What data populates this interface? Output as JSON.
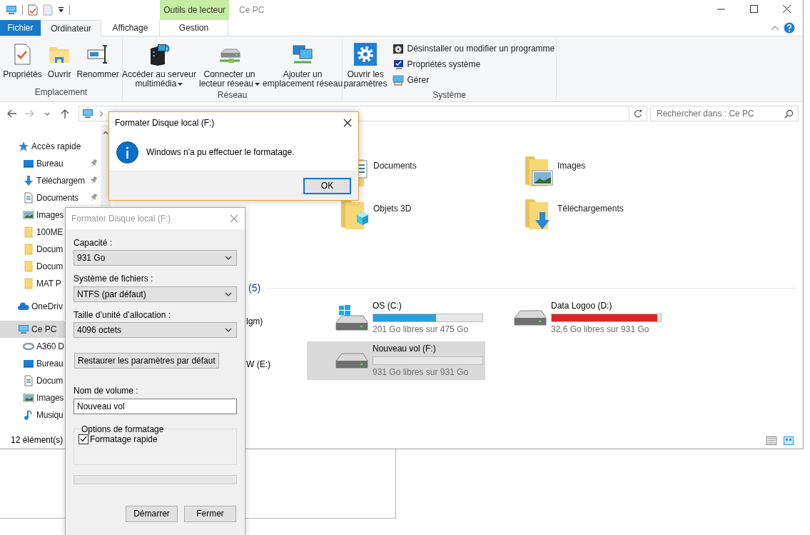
{
  "window": {
    "title": "Ce PC",
    "context_tab": "Outils de lecteur"
  },
  "ribbon_tabs": [
    {
      "label": "Fichier",
      "kind": "file",
      "selected": false
    },
    {
      "label": "Ordinateur",
      "kind": "tab",
      "selected": true
    },
    {
      "label": "Affichage",
      "kind": "tab",
      "selected": false
    },
    {
      "label": "Gestion",
      "kind": "context",
      "selected": false
    }
  ],
  "ribbon_groups": [
    {
      "label": "Emplacement",
      "commands": [
        {
          "label": "Propriétés",
          "kind": "large",
          "dropdown": false
        },
        {
          "label": "Ouvrir",
          "kind": "large",
          "dropdown": false
        },
        {
          "label": "Renommer",
          "kind": "large",
          "dropdown": false
        }
      ]
    },
    {
      "label": "Réseau",
      "commands": [
        {
          "label": "Accéder au serveur\nmultimédia",
          "kind": "large",
          "dropdown": true
        },
        {
          "label": "Connecter un\nlecteur réseau",
          "kind": "large",
          "dropdown": true
        },
        {
          "label": "Ajouter un\nemplacement réseau",
          "kind": "large",
          "dropdown": false
        }
      ]
    },
    {
      "label": "Système",
      "commands": [
        {
          "label": "Ouvrir les\nparamètres",
          "kind": "large",
          "dropdown": false
        },
        {
          "label": "Désinstaller ou modifier un programme",
          "kind": "small",
          "dropdown": false
        },
        {
          "label": "Propriétés système",
          "kind": "small",
          "dropdown": false
        },
        {
          "label": "Gérer",
          "kind": "small",
          "dropdown": false
        }
      ]
    }
  ],
  "search": {
    "placeholder": "Rechercher dans : Ce PC"
  },
  "nav_pane": {
    "items": [
      {
        "label": "Accès rapide",
        "selected": false,
        "children": [
          {
            "label": "Bureau",
            "selected": false,
            "pinned": true
          },
          {
            "label": "Téléchargem",
            "selected": false,
            "pinned": true
          },
          {
            "label": "Documents",
            "selected": false,
            "pinned": true
          },
          {
            "label": "Images",
            "selected": false
          },
          {
            "label": "100ME",
            "selected": false
          },
          {
            "label": "Docum",
            "selected": false
          },
          {
            "label": "Docum",
            "selected": false
          },
          {
            "label": "MAT P",
            "selected": false
          }
        ]
      },
      {
        "label": "OneDriv",
        "selected": false
      },
      {
        "label": "Ce PC",
        "selected": true,
        "children": [
          {
            "label": "A360 D",
            "selected": false
          },
          {
            "label": "Bureau",
            "selected": false
          },
          {
            "label": "Docum",
            "selected": false
          },
          {
            "label": "Images",
            "selected": false
          },
          {
            "label": "Musiqu",
            "selected": false
          }
        ]
      }
    ]
  },
  "content": {
    "folders": [
      {
        "label": "Documents"
      },
      {
        "label": "Images"
      },
      {
        "label": "Objets 3D"
      },
      {
        "label": "Téléchargements"
      }
    ],
    "devices_count": "(5)",
    "cut_labels": [
      "lgm)",
      "W (E:)"
    ],
    "drives": [
      {
        "label": "OS (C:)",
        "kind": "system",
        "level": 0.577,
        "color": "#26a0da",
        "free": "201 Go libres sur 475 Go",
        "selected": false
      },
      {
        "label": "Data Logoo (D:)",
        "kind": "data",
        "level": 0.965,
        "color": "#da2626",
        "free": "32,6 Go libres sur 931 Go",
        "selected": false
      },
      {
        "label": "Nouveau vol (F:)",
        "kind": "data",
        "free": "931 Go libres sur 931 Go",
        "selected": true
      }
    ]
  },
  "status_bar": {
    "item_count": "12 élément(s)"
  },
  "message_box": {
    "title": "Formater Disque local (F:)",
    "text": "Windows n'a pu effectuer le formatage.",
    "button": "OK"
  },
  "format_dialog": {
    "title": "Formater Disque local (F:)",
    "fields": [
      {
        "kind": "select",
        "label": "Capacité :",
        "value": "931 Go"
      },
      {
        "kind": "select",
        "label": "Système de fichiers :",
        "value": "NTFS (par défaut)"
      },
      {
        "kind": "select",
        "label": "Taille d’unité d’allocation :",
        "value": "4096 octets"
      },
      {
        "kind": "button",
        "label": "Restaurer les paramètres par défaut"
      },
      {
        "kind": "input",
        "label": "Nom de volume :",
        "value": "Nouveau vol"
      }
    ],
    "options": {
      "legend": "Options de formatage",
      "checkboxes": [
        {
          "label": "Formatage rapide",
          "checked": true
        }
      ]
    },
    "progress": {
      "level": 0
    },
    "buttons": [
      "Démarrer",
      "Fermer"
    ]
  }
}
